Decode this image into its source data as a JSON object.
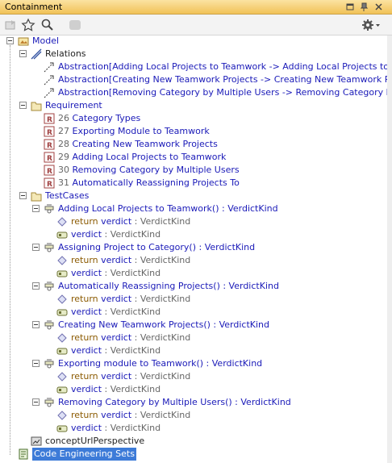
{
  "panel": {
    "title": "Containment"
  },
  "tree": {
    "model": "Model",
    "relations": "Relations",
    "abstractions": [
      "Abstraction[Adding Local Projects to Teamwork -> Adding Local Projects to Teamwo",
      "Abstraction[Creating New Teamwork Projects -> Creating New Teamwork Projects]",
      "Abstraction[Removing Category by Multiple Users -> Removing Category by Multipl"
    ],
    "requirement": "Requirement",
    "requirements": [
      {
        "id": "26",
        "name": "Category Types"
      },
      {
        "id": "27",
        "name": "Exporting Module to Teamwork"
      },
      {
        "id": "28",
        "name": "Creating New Teamwork Projects"
      },
      {
        "id": "29",
        "name": "Adding Local Projects to Teamwork"
      },
      {
        "id": "30",
        "name": "Removing Category by Multiple Users"
      },
      {
        "id": "31",
        "name": "Automatically Reassigning Projects To"
      }
    ],
    "testcases": "TestCases",
    "tests": [
      {
        "name": "Adding Local Projects to Teamwork()",
        "type": " : VerdictKind"
      },
      {
        "name": "Assigning Project to Category()",
        "type": " : VerdictKind"
      },
      {
        "name": "Automatically Reassigning Projects()",
        "type": " : VerdictKind"
      },
      {
        "name": "Creating New Teamwork Projects()",
        "type": " : VerdictKind"
      },
      {
        "name": "Exporting module to Teamwork()",
        "type": " : VerdictKind"
      },
      {
        "name": "Removing Category by Multiple Users()",
        "type": " : VerdictKind"
      }
    ],
    "return_kw": "return",
    "verdict": "verdict",
    "verdict_type": " : VerdictKind",
    "concept": "conceptUrlPerspective",
    "code_eng": "Code Engineering Sets"
  }
}
